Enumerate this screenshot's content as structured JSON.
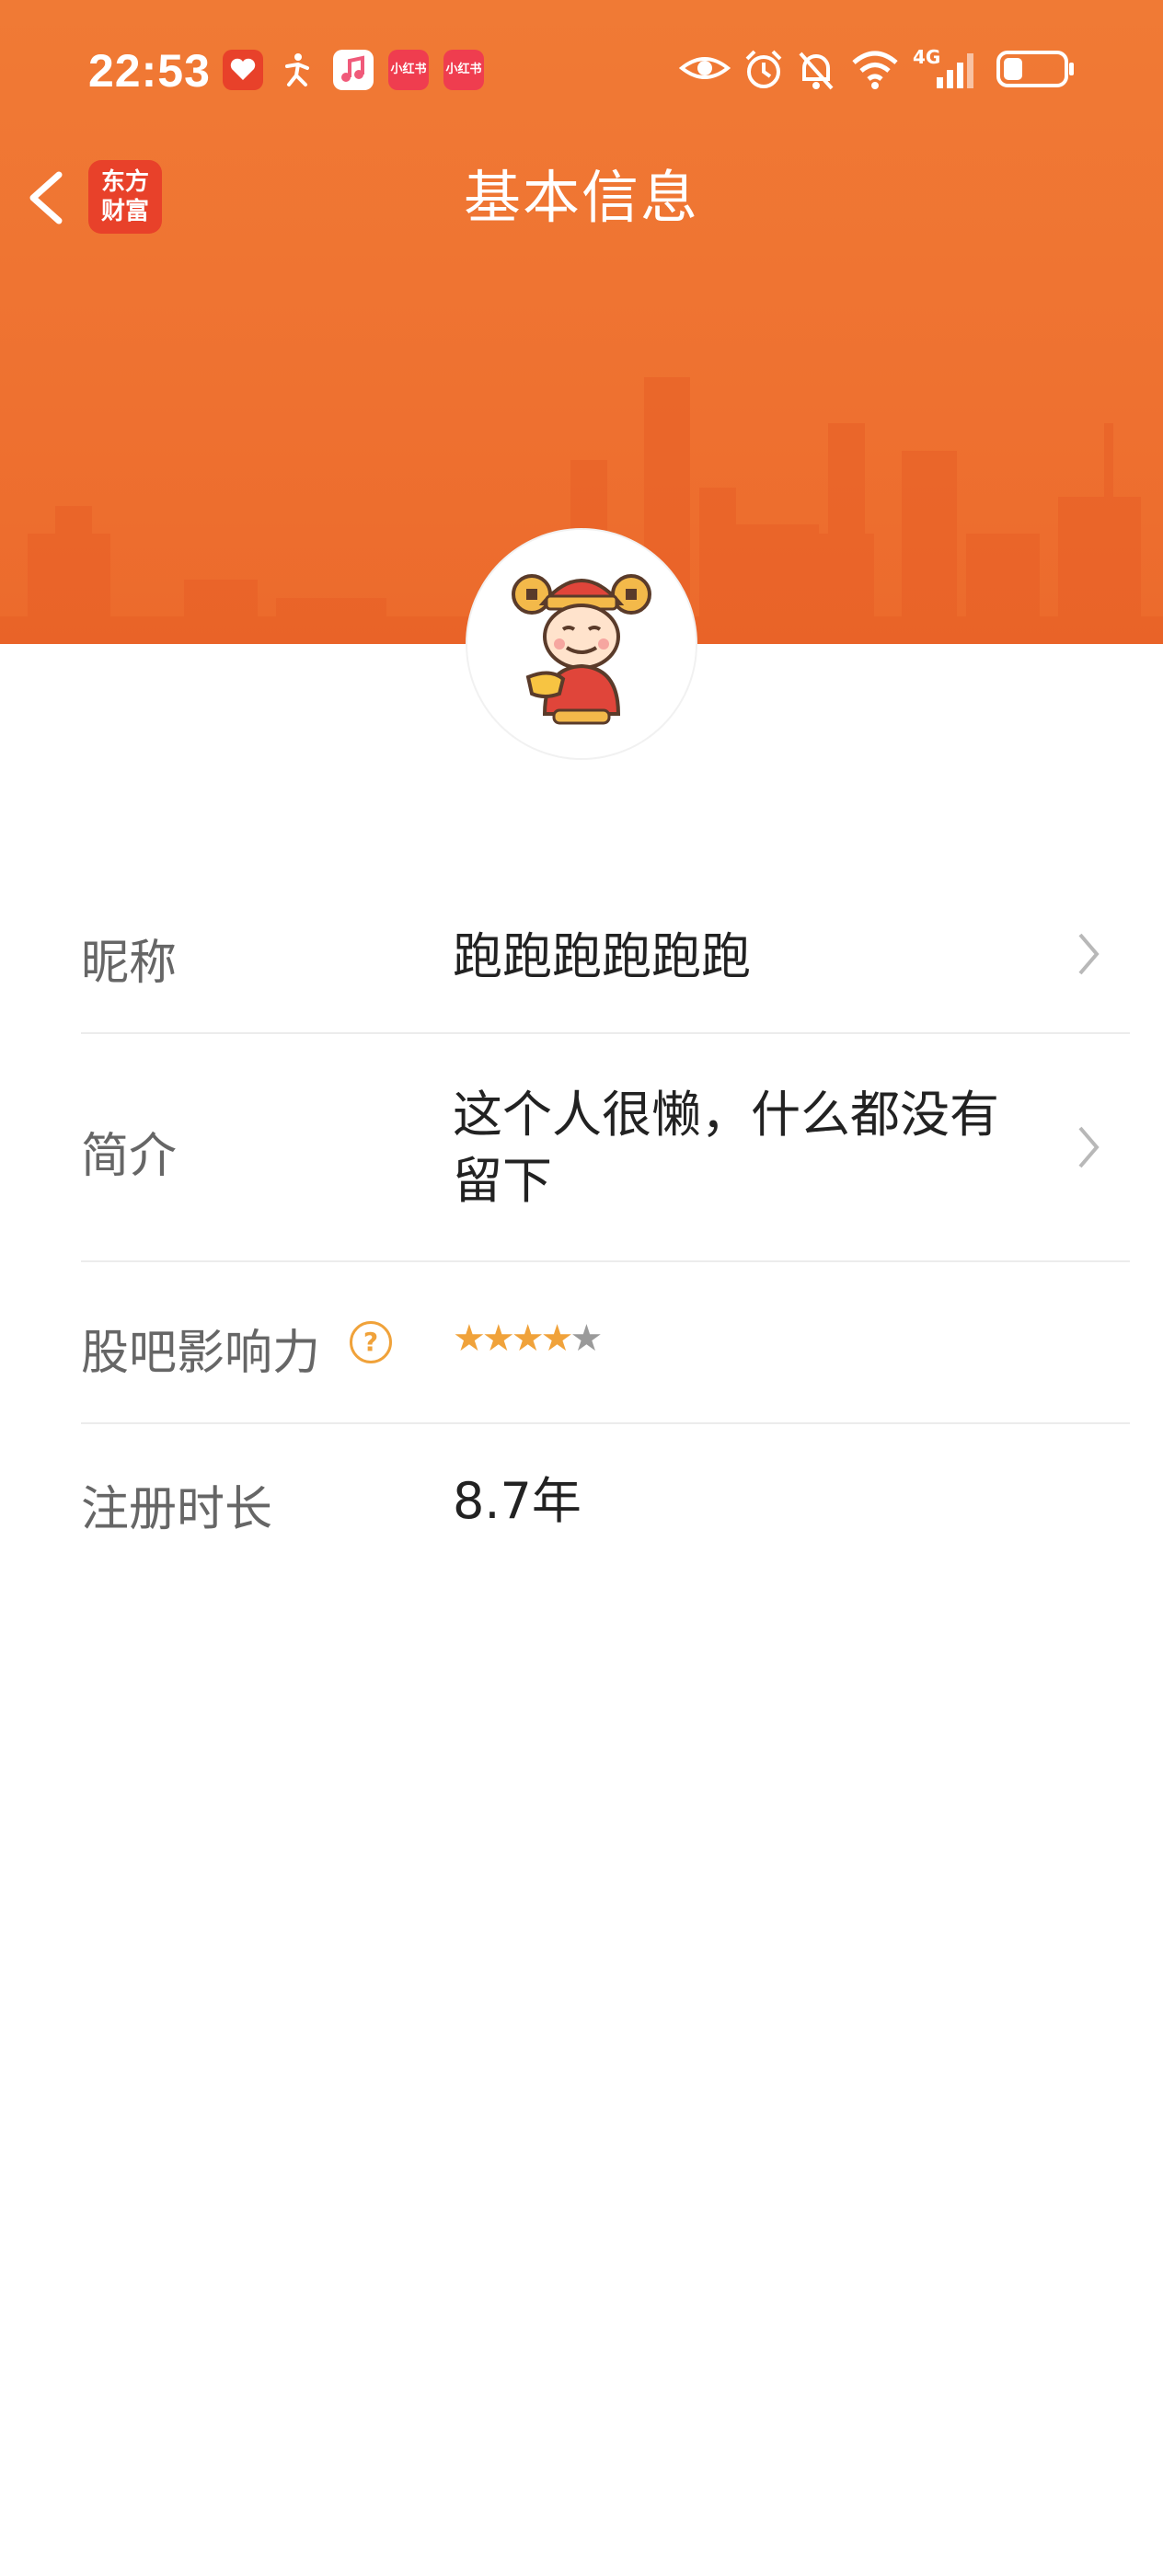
{
  "status_bar": {
    "time": "22:53",
    "app_icons": [
      "heart-app-icon",
      "runner-app-icon",
      "music-app-icon",
      "xiaohongshu-app-icon",
      "xiaohongshu-app-icon"
    ],
    "app_icon_labels": [
      "",
      "",
      "",
      "小红书",
      "小红书"
    ],
    "network": "4G",
    "system_icons": [
      "eye-icon",
      "alarm-icon",
      "bell-off-icon",
      "wifi-icon",
      "signal-icon",
      "battery-icon"
    ]
  },
  "nav": {
    "title": "基本信息",
    "logo_line1": "东方",
    "logo_line2": "财富",
    "back_icon": "chevron-left-icon"
  },
  "colors": {
    "banner": "#ef7432",
    "accent": "#f0a23a",
    "logo_bg": "#e8412a"
  },
  "profile": {
    "rows": [
      {
        "label": "昵称",
        "value": "跑跑跑跑跑跑"
      },
      {
        "label": "简介",
        "value_line1": "这个人很懒，什么都没有",
        "value_line2": "留下"
      },
      {
        "label": "股吧影响力",
        "help_icon": "question-circle-icon",
        "rating": 4,
        "rating_max": 5
      },
      {
        "label": "注册时长",
        "value": "8.7年"
      }
    ]
  }
}
